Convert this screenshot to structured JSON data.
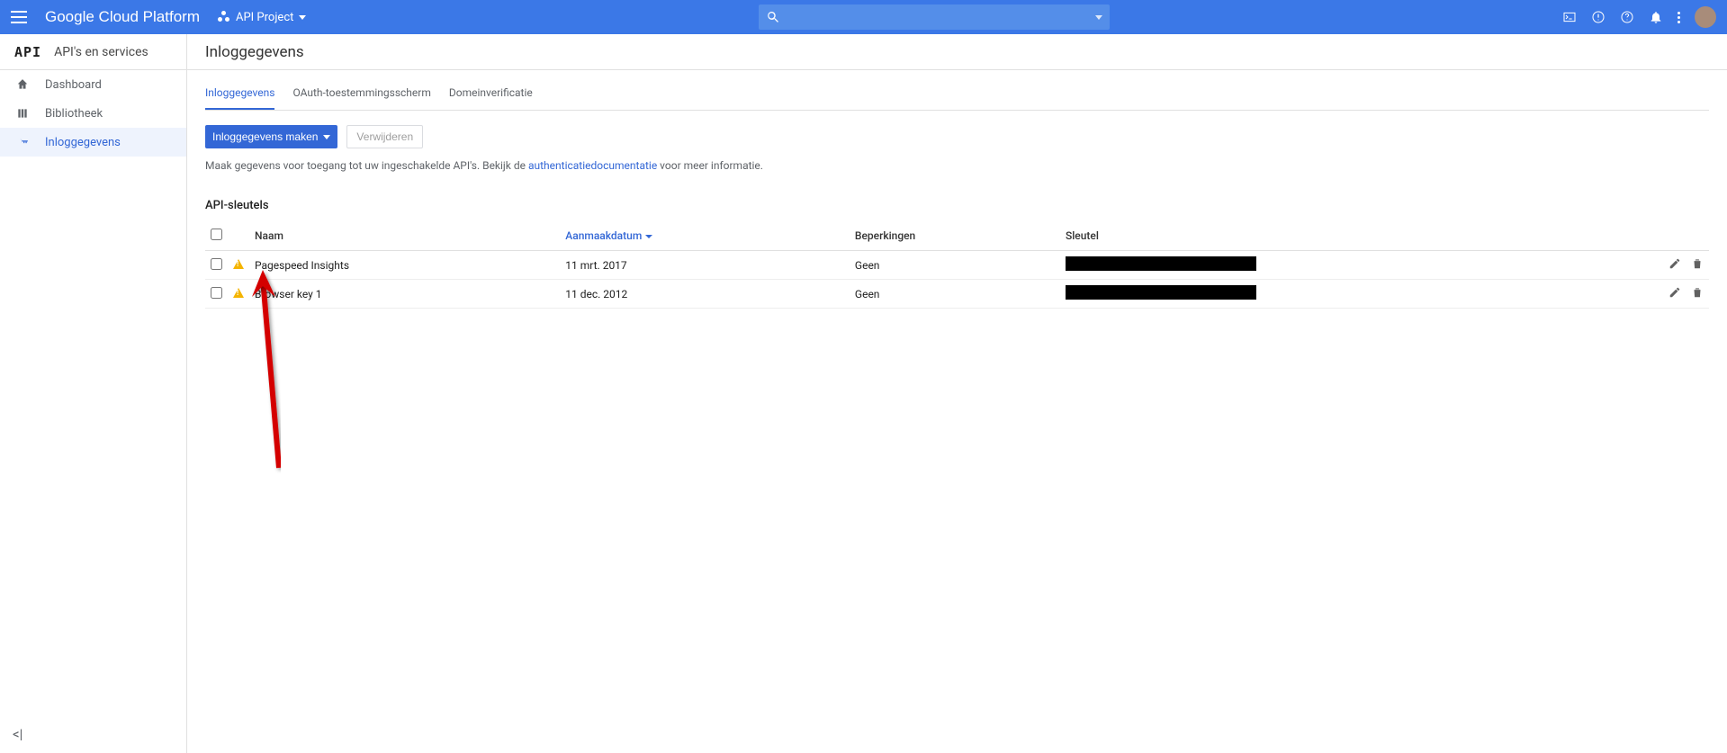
{
  "topbar": {
    "product": "Google Cloud Platform",
    "project": "API Project"
  },
  "sidebar": {
    "api_logo": "API",
    "title": "API's en services",
    "items": [
      {
        "label": "Dashboard"
      },
      {
        "label": "Bibliotheek"
      },
      {
        "label": "Inloggegevens"
      }
    ]
  },
  "page_title": "Inloggegevens",
  "tabs": [
    {
      "label": "Inloggegevens",
      "active": true
    },
    {
      "label": "OAuth-toestemmingsscherm",
      "active": false
    },
    {
      "label": "Domeinverificatie",
      "active": false
    }
  ],
  "toolbar": {
    "create_label": "Inloggegevens maken",
    "delete_label": "Verwijderen"
  },
  "help": {
    "pre": "Maak gegevens voor toegang tot uw ingeschakelde API's. Bekijk de ",
    "link": "authenticatiedocumentatie",
    "post": " voor meer informatie."
  },
  "section_title": "API-sleutels",
  "columns": {
    "name": "Naam",
    "created": "Aanmaakdatum",
    "restrictions": "Beperkingen",
    "key": "Sleutel"
  },
  "rows": [
    {
      "name": "Pagespeed Insights",
      "created": "11 mrt. 2017",
      "restrictions": "Geen"
    },
    {
      "name": "Browser key 1",
      "created": "11 dec. 2012",
      "restrictions": "Geen"
    }
  ]
}
